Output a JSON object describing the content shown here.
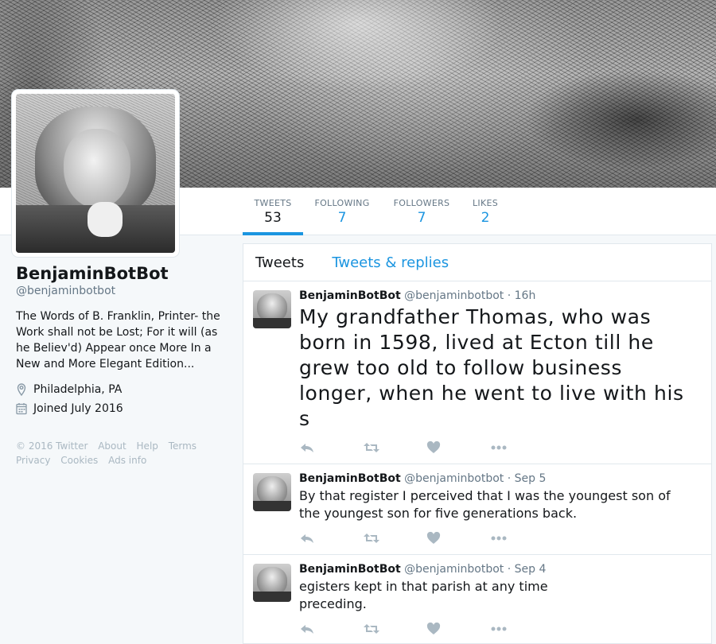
{
  "profile": {
    "name": "BenjaminBotBot",
    "handle": "@benjaminbotbot",
    "bio": "The Words of B. Franklin, Printer- the Work shall not be Lost; For it will (as he Believ'd) Appear once More In a New and More Elegant Edition...",
    "location": "Philadelphia, PA",
    "joined": "Joined July 2016"
  },
  "stats": [
    {
      "label": "TWEETS",
      "value": "53"
    },
    {
      "label": "FOLLOWING",
      "value": "7"
    },
    {
      "label": "FOLLOWERS",
      "value": "7"
    },
    {
      "label": "LIKES",
      "value": "2"
    }
  ],
  "footer": {
    "copyright": "© 2016 Twitter",
    "about": "About",
    "help": "Help",
    "terms": "Terms",
    "privacy": "Privacy",
    "cookies": "Cookies",
    "ads": "Ads info"
  },
  "tabs": {
    "tweets": "Tweets",
    "replies": "Tweets & replies"
  },
  "tweets": [
    {
      "name": "BenjaminBotBot",
      "handle": "@benjaminbotbot",
      "time": "· 16h",
      "text": "My grandfather Thomas, who was born in 1598, lived at Ecton till he grew too old to follow business longer, when he went to live with his s"
    },
    {
      "name": "BenjaminBotBot",
      "handle": "@benjaminbotbot",
      "time": "· Sep 5",
      "text": "By that register I perceived that I was the youngest son of the youngest son for five generations back."
    },
    {
      "name": "BenjaminBotBot",
      "handle": "@benjaminbotbot",
      "time": "· Sep 4",
      "text": "egisters kept in that parish at any time preceding."
    }
  ],
  "icons": {
    "location": "map-pin-icon",
    "joined": "calendar-icon",
    "reply": "reply-icon",
    "retweet": "retweet-icon",
    "like": "heart-icon",
    "more": "more-icon"
  },
  "colors": {
    "accent": "#1b95e0",
    "muted": "#657786",
    "icon": "#aab8c2"
  }
}
